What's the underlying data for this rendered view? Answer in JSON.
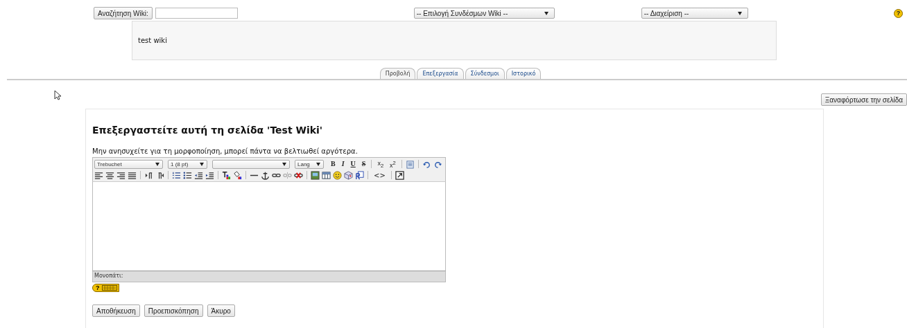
{
  "search": {
    "button": "Αναζήτηση Wiki:"
  },
  "links_select": "-- Επιλογή Συνδέσμων Wiki --",
  "admin_select": "-- Διαχείριση --",
  "help_mark": "?",
  "summary": "test wiki",
  "tabs": [
    {
      "label": "Προβολή",
      "selected": true
    },
    {
      "label": "Επεξεργασία",
      "selected": false
    },
    {
      "label": "Σύνδεσμοι",
      "selected": false
    },
    {
      "label": "Ιστορικό",
      "selected": false
    }
  ],
  "reload_button": "Ξαναφόρτωσε την σελίδα",
  "heading": "Επεξεργαστείτε αυτή τη σελίδα 'Test Wiki'",
  "hint": "Μην ανησυχείτε για τη μορφοποίηση, μπορεί πάντα να βελτιωθεί αργότερα.",
  "toolbar": [
    [
      {
        "kind": "select",
        "label": "Trebuchet"
      },
      {
        "kind": "select",
        "label": "1 (8 pt)"
      },
      {
        "kind": "select"
      },
      {
        "kind": "select",
        "label": "Lang"
      },
      {
        "kind": "bold",
        "label": "B"
      },
      {
        "kind": "italic",
        "label": "I"
      },
      {
        "kind": "underline",
        "label": "U"
      },
      {
        "kind": "strike",
        "label": "S"
      },
      {
        "kind": "sep"
      },
      {
        "kind": "script",
        "label": "x$_{2}$"
      },
      {
        "kind": "script",
        "label": "x$^{2}$"
      },
      {
        "kind": "sep"
      },
      {
        "kind": "icon"
      },
      {
        "kind": "sep"
      },
      {
        "kind": "icon"
      },
      {
        "kind": "icon"
      }
    ],
    [
      {
        "kind": "icon"
      },
      {
        "kind": "icon"
      },
      {
        "kind": "icon"
      },
      {
        "kind": "icon"
      },
      {
        "kind": "sep"
      },
      {
        "kind": "icon"
      },
      {
        "kind": "icon"
      },
      {
        "kind": "sep"
      },
      {
        "kind": "icon"
      },
      {
        "kind": "icon"
      },
      {
        "kind": "icon"
      },
      {
        "kind": "icon"
      },
      {
        "kind": "sep"
      },
      {
        "kind": "icon"
      },
      {
        "kind": "icon"
      },
      {
        "kind": "sep"
      },
      {
        "kind": "icon"
      },
      {
        "kind": "icon"
      },
      {
        "kind": "icon"
      },
      {
        "kind": "icon"
      },
      {
        "kind": "icon"
      },
      {
        "kind": "sep"
      },
      {
        "kind": "icon"
      },
      {
        "kind": "icon"
      },
      {
        "kind": "icon"
      },
      {
        "kind": "icon"
      },
      {
        "kind": "icon"
      },
      {
        "kind": "sep"
      },
      {
        "kind": "code",
        "label": "<>"
      },
      {
        "kind": "sep"
      },
      {
        "kind": "icon"
      }
    ]
  ],
  "editor": {
    "path_label": "Μονοπάτι:"
  },
  "keyboard_badge": "?",
  "buttons": [
    "Αποθήκευση",
    "Προεπισκόπηση",
    "Άκυρο"
  ]
}
